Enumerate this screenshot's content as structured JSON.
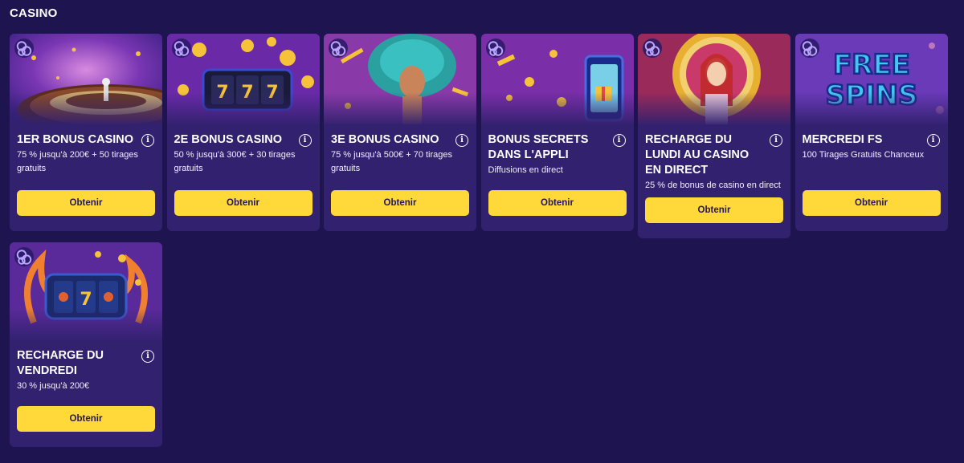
{
  "section": {
    "title": "CASINO"
  },
  "cards": [
    {
      "title": "1ER BONUS CASINO",
      "desc": "75 % jusqu'à 200€ + 50 tirages gratuits",
      "button": "Obtenir",
      "icon": "roulette-image"
    },
    {
      "title": "2E BONUS CASINO",
      "desc": "50 % jusqu'à 300€ + 30 tirages gratuits",
      "button": "Obtenir",
      "icon": "slot-machine-image"
    },
    {
      "title": "3E BONUS CASINO",
      "desc": "75 % jusqu'à 500€ + 70 tirages gratuits",
      "button": "Obtenir",
      "icon": "carnival-dancer-image"
    },
    {
      "title": "BONUS SECRETS DANS L'APPLI",
      "desc": "Diffusions en direct",
      "button": "Obtenir",
      "icon": "phone-app-image"
    },
    {
      "title": "RECHARGE DU LUNDI AU CASINO EN DIRECT",
      "desc": "25 % de bonus de casino en direct",
      "button": "Obtenir",
      "icon": "queen-wheel-image"
    },
    {
      "title": "MERCREDI FS",
      "desc": "100 Tirages Gratuits Chanceux",
      "button": "Obtenir",
      "icon": "free-spins-image",
      "image_text": [
        "FREE",
        "SPINS"
      ]
    },
    {
      "title": "RECHARGE DU VENDREDI",
      "desc": "30 % jusqu'à 200€",
      "button": "Obtenir",
      "icon": "fire-slot-image"
    }
  ],
  "colors": {
    "background": "#1e1450",
    "card": "#31216e",
    "button": "#ffd93a",
    "button_text": "#24165a"
  }
}
